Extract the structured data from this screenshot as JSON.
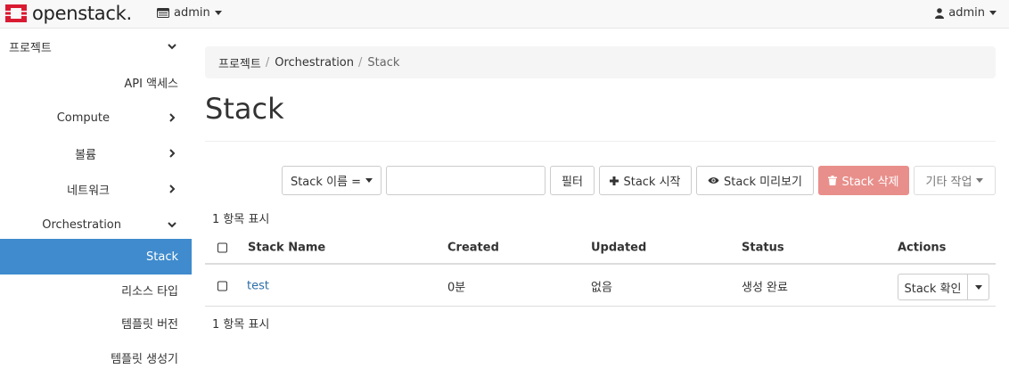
{
  "header": {
    "brand": "openstack",
    "brand_mark": ".",
    "project": "admin",
    "user": "admin"
  },
  "sidebar": {
    "items": [
      {
        "label": "프로젝트",
        "chevron": "down"
      },
      {
        "label": "API 액세스",
        "chevron": ""
      },
      {
        "label": "Compute",
        "chevron": "right"
      },
      {
        "label": "볼륨",
        "chevron": "right"
      },
      {
        "label": "네트워크",
        "chevron": "right"
      },
      {
        "label": "Orchestration",
        "chevron": "down"
      },
      {
        "label": "Stack",
        "chevron": "",
        "active": true
      },
      {
        "label": "리소스 타입",
        "chevron": ""
      },
      {
        "label": "템플릿 버전",
        "chevron": ""
      },
      {
        "label": "템플릿 생성기",
        "chevron": ""
      }
    ]
  },
  "breadcrumb": {
    "items": [
      "프로젝트",
      "Orchestration",
      "Stack"
    ],
    "separator": "/"
  },
  "page": {
    "title": "Stack"
  },
  "toolbar": {
    "filter_field": "Stack 이름 =",
    "filter_input_value": "",
    "filter_button": "필터",
    "launch_button": "Stack 시작",
    "preview_button": "Stack 미리보기",
    "delete_button": "Stack 삭제",
    "more_actions": "기타 작업"
  },
  "table": {
    "count_top": "1 항목 표시",
    "count_bottom": "1 항목 표시",
    "columns": [
      "Stack Name",
      "Created",
      "Updated",
      "Status",
      "Actions"
    ],
    "rows": [
      {
        "name": "test",
        "created": "0분",
        "updated": "없음",
        "status": "생성 완료",
        "action": "Stack 확인"
      }
    ]
  },
  "colors": {
    "active": "#3f8bcd",
    "danger": "#e88f8b",
    "logo": "#da1a32",
    "link": "#2c6ea8"
  }
}
